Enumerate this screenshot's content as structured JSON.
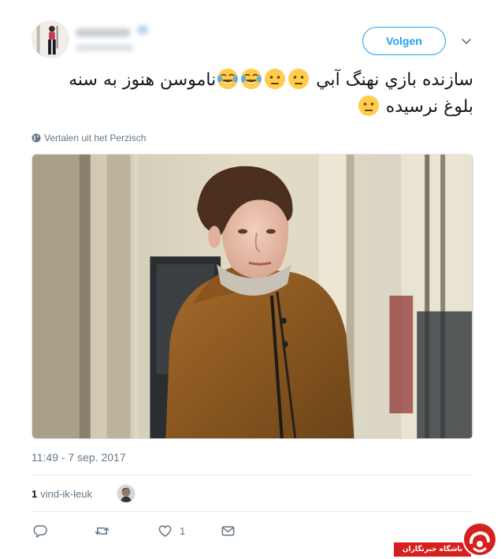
{
  "tweet": {
    "author_avatar": "user-avatar",
    "follow_label": "Volgen",
    "text_line1": "سازنده بازي نهنگ آبي",
    "text_line1_tail": "ناموسن هنوز به سنه",
    "text_line2": "بلوغ نرسیده",
    "emojis": [
      "tears-of-joy-emoji",
      "neutral-face-emoji"
    ],
    "translate_label": "Vertalen uit het Perzisch",
    "timestamp": "11:49 - 7 sep. 2017",
    "likes_count": "1",
    "likes_label": "vind-ik-leuk",
    "actions": {
      "reply_icon": "reply-icon",
      "retweet_icon": "retweet-icon",
      "like_icon": "heart-icon",
      "like_count": "1",
      "dm_icon": "envelope-icon"
    }
  },
  "watermark": {
    "label": "باشگاه خبرنگاران"
  },
  "colors": {
    "accent": "#1da1f2",
    "text": "#14171a",
    "muted": "#657786",
    "watermark_red": "#d6201e"
  }
}
